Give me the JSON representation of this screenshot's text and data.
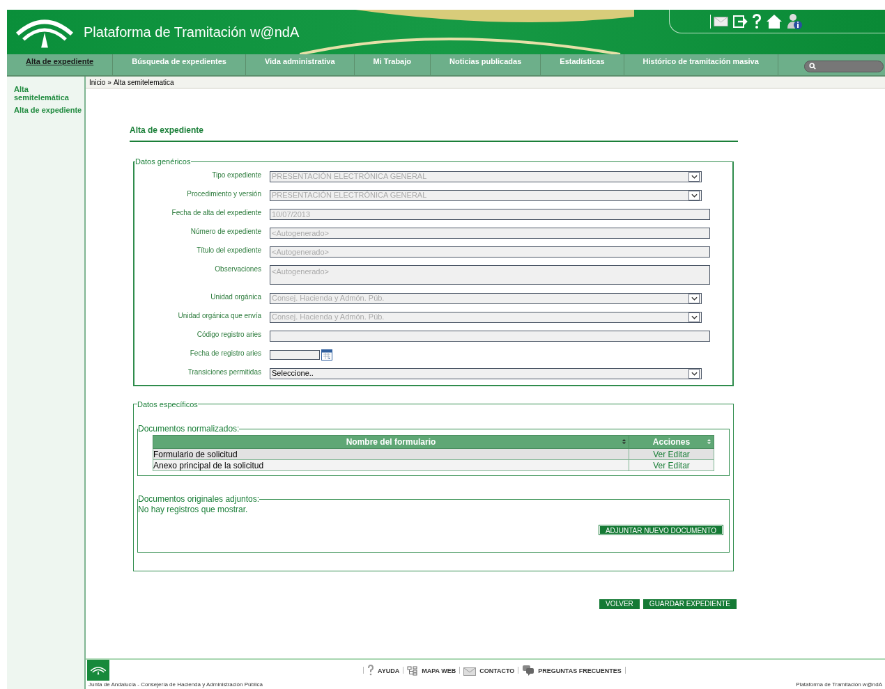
{
  "header": {
    "title": "Plataforma de Tramitación w@ndA"
  },
  "nav": [
    {
      "label": "Alta de expediente",
      "selected": true
    },
    {
      "label": "Búsqueda de expedientes",
      "selected": false
    },
    {
      "label": "Vida administrativa",
      "selected": false
    },
    {
      "label": "Mi Trabajo",
      "selected": false
    },
    {
      "label": "Noticias publicadas",
      "selected": false
    },
    {
      "label": "Estadísticas",
      "selected": false
    },
    {
      "label": "Histórico de tramitación masiva",
      "selected": false
    }
  ],
  "sidebar": {
    "items": [
      "Alta semitelemática",
      "Alta de expediente"
    ]
  },
  "breadcrumb": [
    "Inicio",
    "»",
    "Alta semitelematica"
  ],
  "page_title": "Alta de expediente",
  "generic": {
    "legend": "Datos genéricos",
    "fields": [
      {
        "label": "Tipo expediente",
        "kind": "select",
        "value": "PRESENTACIÓN ELECTRÓNICA GENERAL",
        "disabled": true
      },
      {
        "label": "Procedimiento y versión",
        "kind": "select",
        "value": "PRESENTACIÓN ELECTRÓNICA GENERAL",
        "disabled": true
      },
      {
        "label": "Fecha de alta del expediente",
        "kind": "text",
        "value": "10/07/2013",
        "disabled": true
      },
      {
        "label": "Número de expediente",
        "kind": "text",
        "value": "<Autogenerado>",
        "disabled": true
      },
      {
        "label": "Título del expediente",
        "kind": "text",
        "value": "<Autogenerado>",
        "disabled": true
      },
      {
        "label": "Observaciones",
        "kind": "textarea",
        "value": "<Autogenerado>",
        "disabled": true
      },
      {
        "label": "Unidad orgánica",
        "kind": "select",
        "value": "Consej. Hacienda y Admón. Púb.",
        "disabled": true
      },
      {
        "label": "Unidad orgánica que envía",
        "kind": "select",
        "value": "Consej. Hacienda y Admón. Púb.",
        "disabled": true
      },
      {
        "label": "Código registro aries",
        "kind": "text"
      },
      {
        "label": "Fecha de registro aries",
        "kind": "date"
      },
      {
        "label": "Transiciones permitidas",
        "kind": "select",
        "value": "Seleccione..",
        "disabled": false
      }
    ]
  },
  "specific": {
    "legend": "Datos específicos",
    "normalized": {
      "legend": "Documentos normalizados:",
      "columns": [
        "Nombre del formulario",
        "Acciones"
      ],
      "rows": [
        {
          "name": "Formulario de solicitud",
          "actions": [
            "Ver",
            "Editar"
          ]
        },
        {
          "name": "Anexo principal de la solicitud",
          "actions": [
            "Ver",
            "Editar"
          ]
        }
      ]
    },
    "originals": {
      "legend": "Documentos originales adjuntos:",
      "empty": "No hay registros que mostrar.",
      "button": "ADJUNTAR NUEVO DOCUMENTO"
    }
  },
  "actions": [
    "VOLVER",
    "GUARDAR EXPEDIENTE"
  ],
  "footer": {
    "links": [
      "AYUDA",
      "MAPA WEB",
      "CONTACTO",
      "PREGUNTAS FRECUENTES"
    ],
    "left": "Junta de Andalucía - Consejería de Hacienda y Administración Pública",
    "right": "Plataforma de Tramitación w@ndA"
  }
}
